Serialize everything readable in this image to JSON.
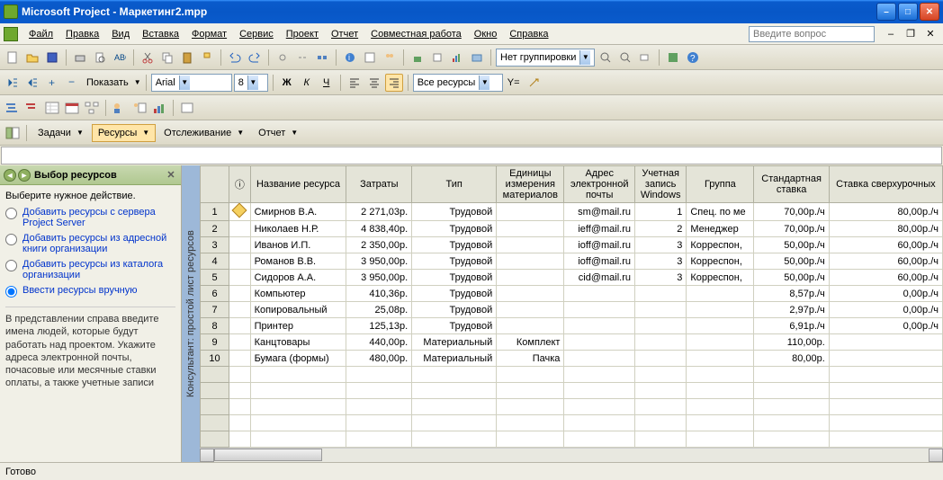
{
  "window": {
    "title": "Microsoft Project - Маркетинг2.mpp"
  },
  "menu": {
    "file": "Файл",
    "edit": "Правка",
    "view": "Вид",
    "insert": "Вставка",
    "format": "Формат",
    "tools": "Сервис",
    "project": "Проект",
    "report": "Отчет",
    "collab": "Совместная работа",
    "window": "Окно",
    "help": "Справка",
    "help_placeholder": "Введите вопрос"
  },
  "toolbar": {
    "show_label": "Показать",
    "font_name": "Arial",
    "font_size": "8",
    "bold": "Ж",
    "italic": "К",
    "underline": "Ч",
    "grouping": "Нет группировки",
    "filter": "Все ресурсы",
    "y_symbol": "Y="
  },
  "nav": {
    "tasks": "Задачи",
    "resources": "Ресурсы",
    "tracking": "Отслеживание",
    "report": "Отчет"
  },
  "sidepanel": {
    "title": "Выбор ресурсов",
    "prompt": "Выберите нужное действие.",
    "opt1": "Добавить ресурсы с сервера Project Server",
    "opt2": "Добавить ресурсы из адресной книги организации",
    "opt3": "Добавить ресурсы из каталога организации",
    "opt4": "Ввести ресурсы вручную",
    "hint": "В представлении справа введите имена людей, которые будут работать над проектом. Укажите адреса электронной почты, почасовые или месячные ставки оплаты, а также учетные записи"
  },
  "grid": {
    "vtab_label": "Консультант: простой лист ресурсов",
    "info_icon": "ⓘ",
    "headers": {
      "name": "Название ресурса",
      "cost": "Затраты",
      "type": "Тип",
      "units": "Единицы измерения материалов",
      "email": "Адрес электронной почты",
      "account": "Учетная запись Windows",
      "group": "Группа",
      "std_rate": "Стандартная ставка",
      "ovt_rate": "Ставка сверхурочных"
    },
    "rows": [
      {
        "n": 1,
        "info": true,
        "name": "Смирнов В.А.",
        "cost": "2 271,03р.",
        "type": "Трудовой",
        "units": "",
        "email": "sm@mail.ru",
        "acct": "1",
        "group": "Спец. по ме",
        "std": "70,00р./ч",
        "ovt": "80,00р./ч"
      },
      {
        "n": 2,
        "info": false,
        "name": "Николаев Н.Р.",
        "cost": "4 838,40р.",
        "type": "Трудовой",
        "units": "",
        "email": "ieff@mail.ru",
        "acct": "2",
        "group": "Менеджер",
        "std": "70,00р./ч",
        "ovt": "80,00р./ч"
      },
      {
        "n": 3,
        "info": false,
        "name": "Иванов И.П.",
        "cost": "2 350,00р.",
        "type": "Трудовой",
        "units": "",
        "email": "ioff@mail.ru",
        "acct": "3",
        "group": "Корреспон,",
        "std": "50,00р./ч",
        "ovt": "60,00р./ч"
      },
      {
        "n": 4,
        "info": false,
        "name": "Романов В.В.",
        "cost": "3 950,00р.",
        "type": "Трудовой",
        "units": "",
        "email": "ioff@mail.ru",
        "acct": "3",
        "group": "Корреспон,",
        "std": "50,00р./ч",
        "ovt": "60,00р./ч"
      },
      {
        "n": 5,
        "info": false,
        "name": "Сидоров А.А.",
        "cost": "3 950,00р.",
        "type": "Трудовой",
        "units": "",
        "email": "cid@mail.ru",
        "acct": "3",
        "group": "Корреспон,",
        "std": "50,00р./ч",
        "ovt": "60,00р./ч"
      },
      {
        "n": 6,
        "info": false,
        "name": "Компьютер",
        "cost": "410,36р.",
        "type": "Трудовой",
        "units": "",
        "email": "",
        "acct": "",
        "group": "",
        "std": "8,57р./ч",
        "ovt": "0,00р./ч"
      },
      {
        "n": 7,
        "info": false,
        "name": "Копировальный",
        "cost": "25,08р.",
        "type": "Трудовой",
        "units": "",
        "email": "",
        "acct": "",
        "group": "",
        "std": "2,97р./ч",
        "ovt": "0,00р./ч"
      },
      {
        "n": 8,
        "info": false,
        "name": "Принтер",
        "cost": "125,13р.",
        "type": "Трудовой",
        "units": "",
        "email": "",
        "acct": "",
        "group": "",
        "std": "6,91р./ч",
        "ovt": "0,00р./ч"
      },
      {
        "n": 9,
        "info": false,
        "name": "Канцтовары",
        "cost": "440,00р.",
        "type": "Материальный",
        "units": "Комплект",
        "email": "",
        "acct": "",
        "group": "",
        "std": "110,00р.",
        "ovt": ""
      },
      {
        "n": 10,
        "info": false,
        "name": "Бумага (формы)",
        "cost": "480,00р.",
        "type": "Материальный",
        "units": "Пачка",
        "email": "",
        "acct": "",
        "group": "",
        "std": "80,00р.",
        "ovt": ""
      }
    ]
  },
  "status": {
    "text": "Готово"
  }
}
